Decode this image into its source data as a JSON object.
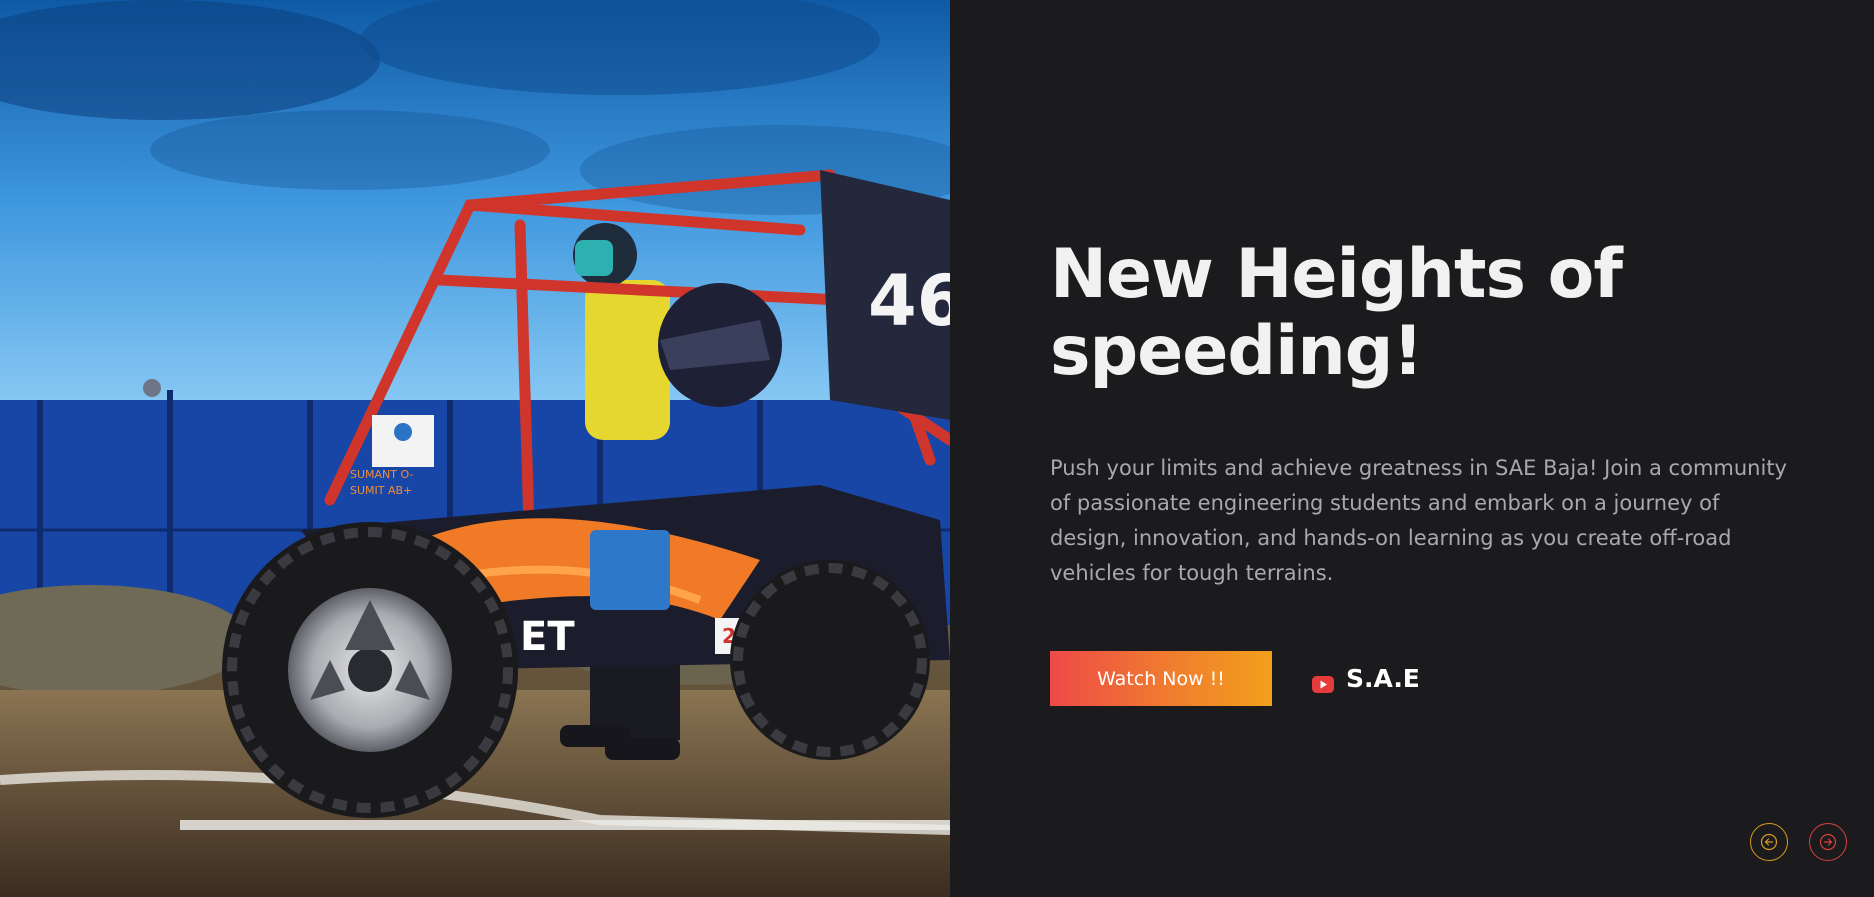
{
  "hero": {
    "headline": "New Heights of speeding!",
    "description": "Push your limits and achieve greatness in SAE Baja! Join a community of passionate engineering students and embark on a journey of design, innovation, and hands-on learning as you create off-road vehicles for tough terrains.",
    "watch_button_label": "Watch Now !!",
    "sae_link_label": "S.A.E",
    "photo_alt": "SAE Baja off-road buggy with driver"
  },
  "photo": {
    "car_number": "46",
    "decal_name_1": "SUMANT O-",
    "decal_name_2": "SUMIT AB+",
    "sponsor_badge": "24x7",
    "side_text": "ET"
  },
  "nav": {
    "prev_icon": "arrow-left-circle-icon",
    "next_icon": "arrow-right-circle-icon"
  },
  "colors": {
    "background": "#1b1b1d",
    "headline": "#f1f1f1",
    "description": "#a9a9ad",
    "button_gradient_start": "#ee4a48",
    "button_gradient_end": "#f2a01c",
    "youtube_red": "#e63b3b",
    "prev_ring": "#d99a1f",
    "next_ring": "#d9423f"
  }
}
